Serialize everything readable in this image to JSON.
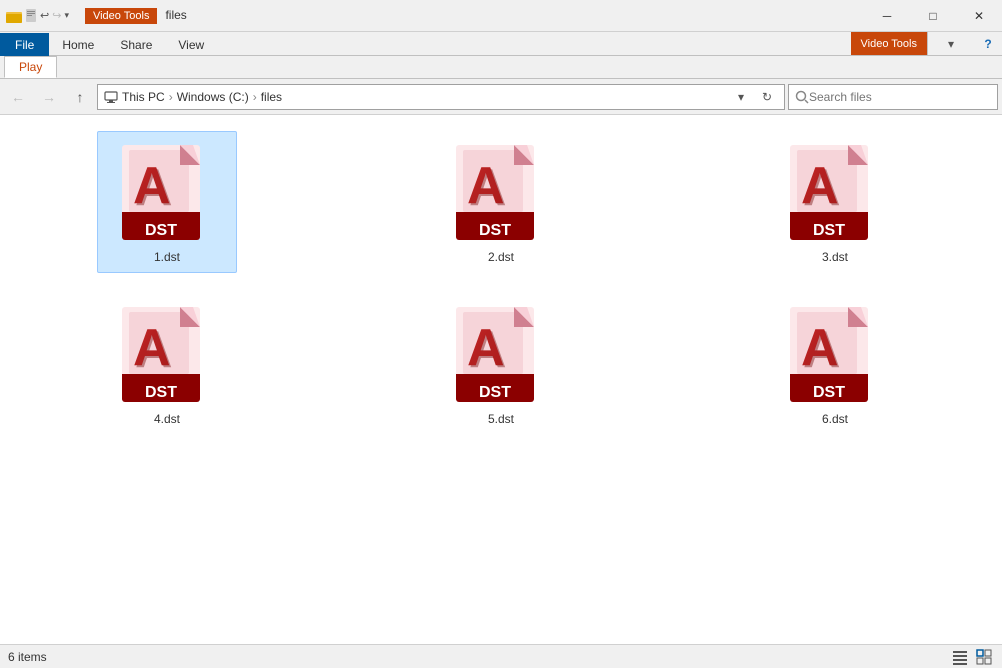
{
  "titlebar": {
    "icons": [
      "save-icon",
      "undo-icon",
      "redo-icon"
    ],
    "video_tools_label": "Video Tools",
    "folder_label": "files",
    "window_controls": {
      "minimize": "─",
      "maximize": "□",
      "close": "✕"
    }
  },
  "ribbon": {
    "tabs": [
      {
        "id": "file",
        "label": "File",
        "active": false
      },
      {
        "id": "home",
        "label": "Home",
        "active": false
      },
      {
        "id": "share",
        "label": "Share",
        "active": false
      },
      {
        "id": "view",
        "label": "View",
        "active": false
      }
    ],
    "video_tools_label": "Video Tools",
    "play_tab_label": "Play"
  },
  "nav": {
    "breadcrumb": {
      "this_pc": "This PC",
      "windows_c": "Windows (C:)",
      "files": "files"
    },
    "search_placeholder": "Search files"
  },
  "files": [
    {
      "id": 1,
      "name": "1.dst",
      "selected": true
    },
    {
      "id": 2,
      "name": "2.dst",
      "selected": false
    },
    {
      "id": 3,
      "name": "3.dst",
      "selected": false
    },
    {
      "id": 4,
      "name": "4.dst",
      "selected": false
    },
    {
      "id": 5,
      "name": "5.dst",
      "selected": false
    },
    {
      "id": 6,
      "name": "6.dst",
      "selected": false
    }
  ],
  "statusbar": {
    "items_count": "6 items",
    "selected_info": ""
  },
  "colors": {
    "accent_blue": "#005a9e",
    "accent_orange": "#c8470a",
    "dst_dark_red": "#8b0000",
    "dst_mid_red": "#c0392b",
    "dst_light_pink": "#f8d7da",
    "selected_bg": "#cce8ff",
    "selected_border": "#99c9ff"
  }
}
